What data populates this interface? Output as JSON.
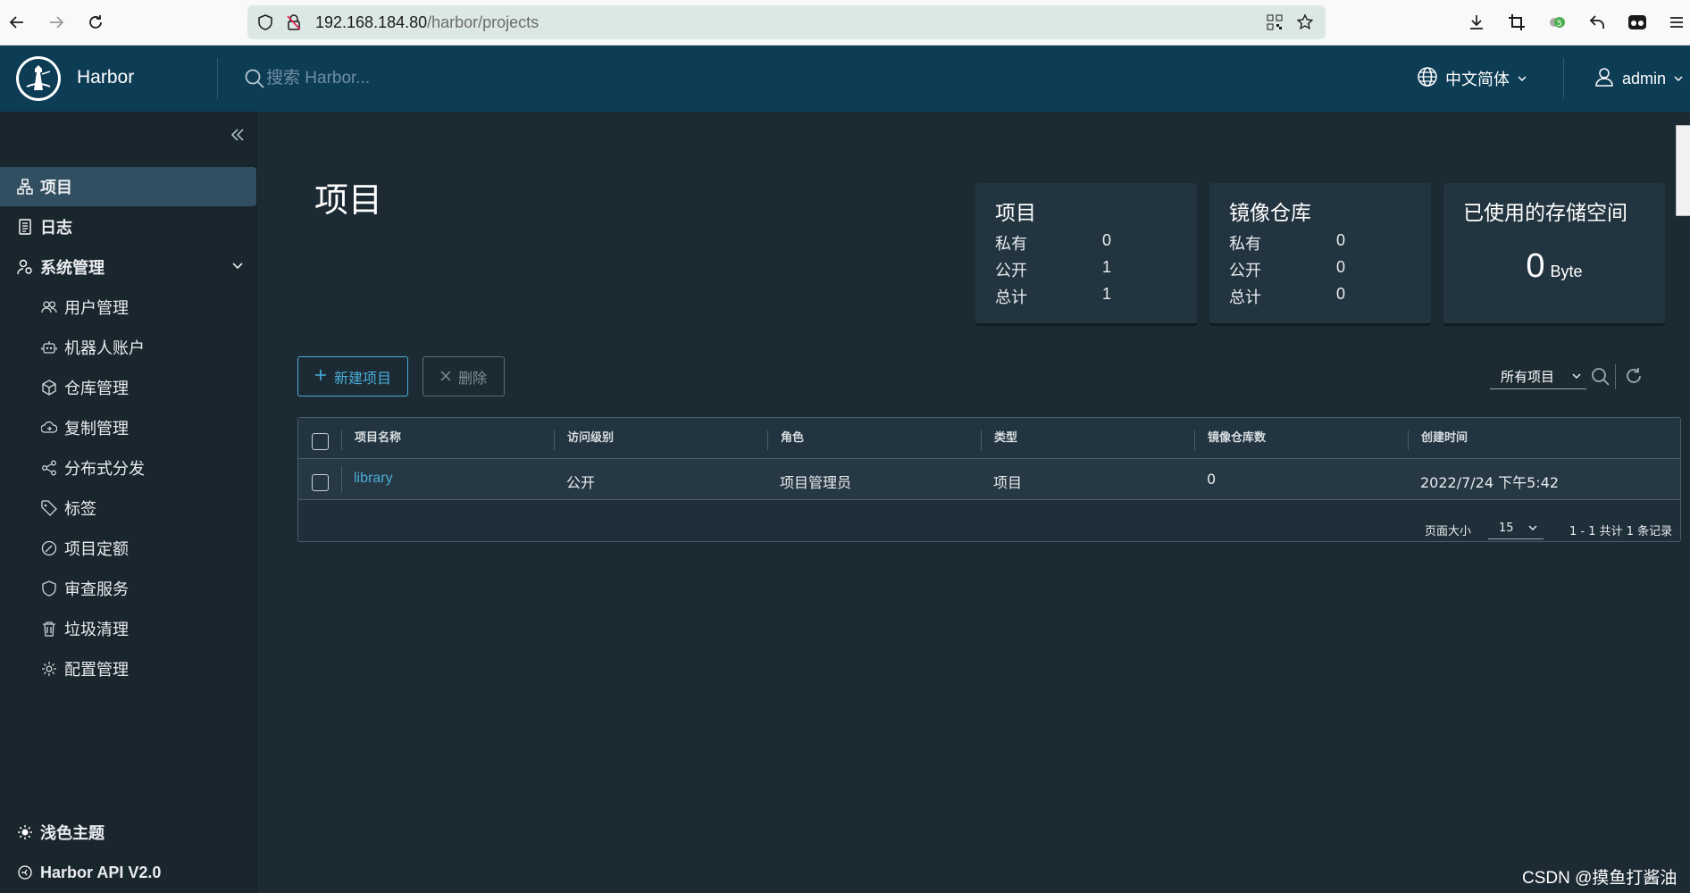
{
  "browser": {
    "url_host": "192.168.184.80",
    "url_path": "/harbor/projects"
  },
  "header": {
    "app_title": "Harbor",
    "search_placeholder": "搜索 Harbor...",
    "language": "中文简体",
    "user": "admin"
  },
  "sidebar": {
    "items": [
      {
        "label": "项目",
        "icon": "projects-icon"
      },
      {
        "label": "日志",
        "icon": "logs-icon"
      },
      {
        "label": "系统管理",
        "icon": "admin-icon"
      }
    ],
    "sub_items": [
      {
        "label": "用户管理",
        "icon": "users-icon"
      },
      {
        "label": "机器人账户",
        "icon": "robot-icon"
      },
      {
        "label": "仓库管理",
        "icon": "registry-icon"
      },
      {
        "label": "复制管理",
        "icon": "replication-icon"
      },
      {
        "label": "分布式分发",
        "icon": "share-icon"
      },
      {
        "label": "标签",
        "icon": "tag-icon"
      },
      {
        "label": "项目定额",
        "icon": "quota-icon"
      },
      {
        "label": "审查服务",
        "icon": "shield-icon"
      },
      {
        "label": "垃圾清理",
        "icon": "trash-icon"
      },
      {
        "label": "配置管理",
        "icon": "gear-icon"
      }
    ],
    "theme_label": "浅色主题",
    "api_label": "Harbor API V2.0"
  },
  "main": {
    "page_title": "项目",
    "cards": {
      "projects": {
        "title": "项目",
        "rows": [
          {
            "label": "私有",
            "value": "0"
          },
          {
            "label": "公开",
            "value": "1"
          },
          {
            "label": "总计",
            "value": "1"
          }
        ]
      },
      "repos": {
        "title": "镜像仓库",
        "rows": [
          {
            "label": "私有",
            "value": "0"
          },
          {
            "label": "公开",
            "value": "0"
          },
          {
            "label": "总计",
            "value": "0"
          }
        ]
      },
      "storage": {
        "title": "已使用的存储空间",
        "value": "0",
        "unit": "Byte"
      }
    },
    "buttons": {
      "new_project": "新建项目",
      "delete": "删除"
    },
    "filter": "所有项目",
    "table": {
      "headers": [
        "项目名称",
        "访问级别",
        "角色",
        "类型",
        "镜像仓库数",
        "创建时间"
      ],
      "rows": [
        [
          "library",
          "公开",
          "项目管理员",
          "项目",
          "0",
          "2022/7/24 下午5:42"
        ]
      ],
      "page_size_label": "页面大小",
      "page_size": "15",
      "summary": "1 - 1 共计 1 条记录"
    }
  },
  "watermark": "CSDN @摸鱼打酱油"
}
